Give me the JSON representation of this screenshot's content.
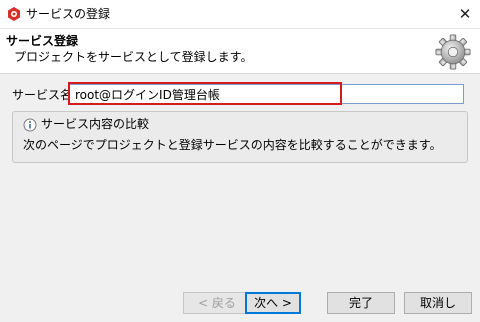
{
  "window": {
    "title": "サービスの登録",
    "close_glyph": "✕"
  },
  "header": {
    "title": "サービス登録",
    "description": "プロジェクトをサービスとして登録します。"
  },
  "form": {
    "label": "サービス名",
    "value": "root@ログインID管理台帳"
  },
  "info": {
    "title": "サービス内容の比較",
    "text": "次のページでプロジェクトと登録サービスの内容を比較することができます。"
  },
  "buttons": {
    "back": "< 戻る",
    "next": "次へ >",
    "finish": "完了",
    "cancel": "取消し"
  },
  "colors": {
    "highlight": "#d41a1a",
    "app_icon": "#d9302c"
  },
  "icons": {
    "app": "app-icon",
    "gear": "gear-icon",
    "info": "info-icon",
    "close": "close-icon"
  }
}
